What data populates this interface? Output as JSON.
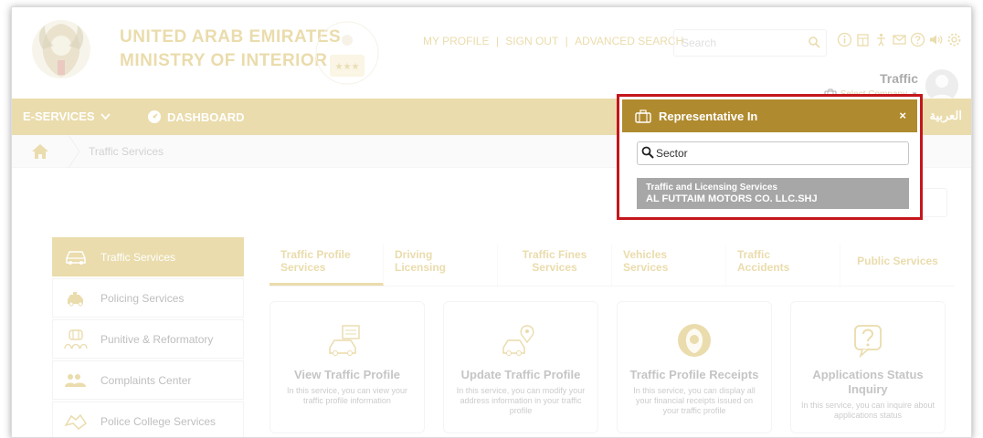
{
  "header": {
    "ministry_line1": "UNITED ARAB EMIRATES",
    "ministry_line2": "MINISTRY OF INTERIOR",
    "links": [
      "MY PROFILE",
      "SIGN OUT",
      "ADVANCED SEARCH"
    ],
    "link_separator": "|",
    "search_placeholder": "Search",
    "user_name": "Traffic",
    "select_company_label": "Select Company",
    "icons": [
      "info-icon",
      "building-icon",
      "accessibility-icon",
      "mail-icon",
      "help-icon",
      "sound-icon",
      "settings-icon"
    ],
    "brand_color": "#c9a227"
  },
  "nav": {
    "eservices_label": "E-SERVICES",
    "dashboard_label": "DASHBOARD",
    "language_label": "العربية"
  },
  "breadcrumb": {
    "current": "Traffic Services"
  },
  "sidebar": {
    "items": [
      {
        "label": "Traffic Services",
        "icon": "car-icon"
      },
      {
        "label": "Policing Services",
        "icon": "police-car-icon"
      },
      {
        "label": "Punitive & Reformatory",
        "icon": "prison-icon"
      },
      {
        "label": "Complaints Center",
        "icon": "people-icon"
      },
      {
        "label": "Police College Services",
        "icon": "handshake-icon"
      }
    ]
  },
  "tabs": [
    {
      "line1": "Traffic Profile",
      "line2": "Services"
    },
    {
      "line1": "Driving",
      "line2": "Licensing"
    },
    {
      "line1": "Traffic Fines",
      "line2": "Services"
    },
    {
      "line1": "Vehicles",
      "line2": "Services"
    },
    {
      "line1": "Traffic",
      "line2": "Accidents"
    },
    {
      "line1": "Public Services",
      "line2": ""
    }
  ],
  "cards": [
    {
      "title": "View Traffic Profile",
      "desc": "In this service, you can view your traffic profile information",
      "icon": "car-document-icon"
    },
    {
      "title": "Update Traffic Profile",
      "desc": "In this service, you can modify your address information in your traffic profile",
      "icon": "car-location-icon"
    },
    {
      "title": "Traffic Profile Receipts",
      "desc": "In this service, you can display all your financial receipts issued on your traffic profile",
      "icon": "emblem-icon"
    },
    {
      "title": "Applications Status Inquiry",
      "desc": "In this service, you can inquire about applications status",
      "icon": "question-icon"
    }
  ],
  "popup": {
    "title": "Representative In",
    "close_label": "×",
    "search_value": "Sector",
    "result_line1": "Traffic and Licensing Services",
    "result_line2": "AL FUTTAIM MOTORS CO. LLC.SHJ",
    "header_color": "#b08a2e",
    "highlight_color": "#c4161c"
  }
}
